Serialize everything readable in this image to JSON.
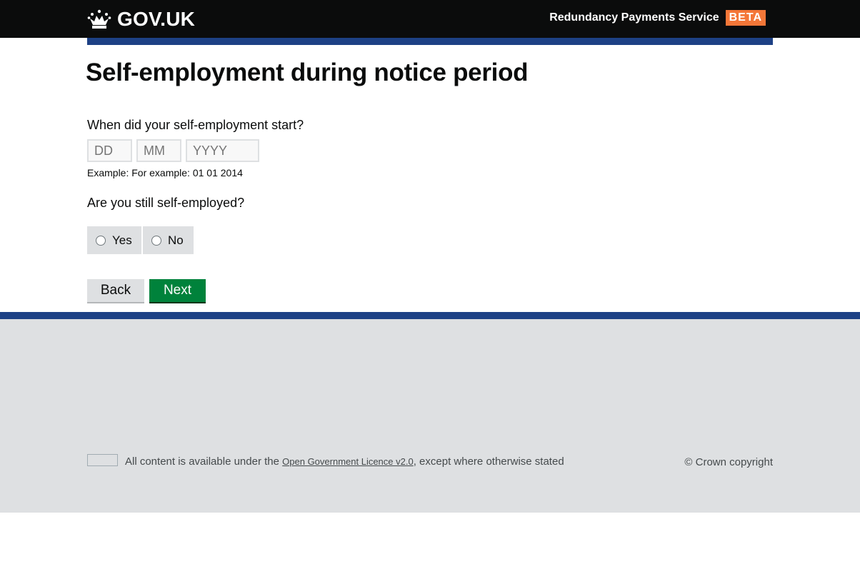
{
  "header": {
    "logo_text": "GOV.UK",
    "service_name": "Redundancy Payments Service",
    "phase_tag": "BETA",
    "phase_color": "#f47738"
  },
  "page": {
    "title": "Self-employment during notice period"
  },
  "form": {
    "start_question": "When did your self-employment start?",
    "day_placeholder": "DD",
    "month_placeholder": "MM",
    "year_placeholder": "YYYY",
    "hint": "Example: For example: 01 01 2014",
    "still_question": "Are you still self-employed?",
    "options": [
      {
        "label": "Yes"
      },
      {
        "label": "No"
      }
    ],
    "back_label": "Back",
    "next_label": "Next",
    "next_color": "#00823b"
  },
  "footer": {
    "licence_prefix": "All content is available under the",
    "licence_link": "Open Government Licence v2.0",
    "licence_suffix": ", except where otherwise stated",
    "copyright": "© Crown copyright"
  },
  "colors": {
    "header_bg": "#0b0c0c",
    "blue_bar": "#1d4185",
    "footer_bg": "#dee0e2"
  }
}
